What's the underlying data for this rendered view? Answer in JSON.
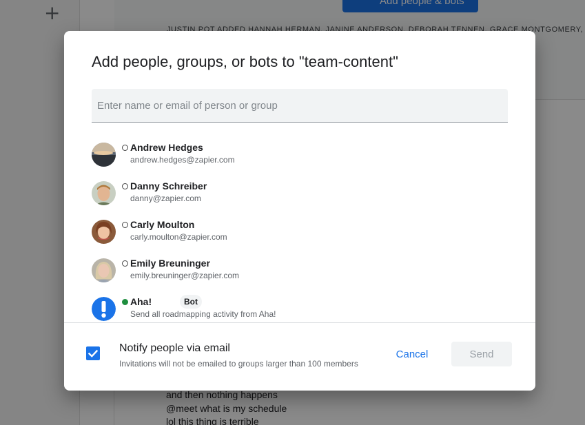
{
  "background": {
    "add_button_label": "Add people & bots",
    "system_message": "JUSTIN POT ADDED HANNAH HERMAN, JANINE ANDERSON, DEBORAH TENNEN, GRACE MONTGOMERY, KRY",
    "chat_lines": [
      "and then nothing happens",
      "@meet what is my schedule",
      "lol this thing is terrible"
    ]
  },
  "dialog": {
    "title": "Add people, groups, or bots to \"team-content\"",
    "search_placeholder": "Enter name or email of person or group",
    "search_value": "",
    "people": [
      {
        "name": "Andrew Hedges",
        "email": "andrew.hedges@zapier.com",
        "status": "away"
      },
      {
        "name": "Danny Schreiber",
        "email": "danny@zapier.com",
        "status": "away"
      },
      {
        "name": "Carly Moulton",
        "email": "carly.moulton@zapier.com",
        "status": "away"
      },
      {
        "name": "Emily Breuninger",
        "email": "emily.breuninger@zapier.com",
        "status": "away"
      },
      {
        "name": "Aha!",
        "badge": "Bot",
        "description": "Send all roadmapping activity from Aha!",
        "status": "online"
      }
    ],
    "notify": {
      "checked": true,
      "label": "Notify people via email",
      "hint": "Invitations will not be emailed to groups larger than 100 members"
    },
    "cancel_label": "Cancel",
    "send_label": "Send"
  },
  "colors": {
    "accent": "#1a73e8",
    "online": "#1e8e3e",
    "scrim": "rgba(0,0,0,0.46)"
  }
}
